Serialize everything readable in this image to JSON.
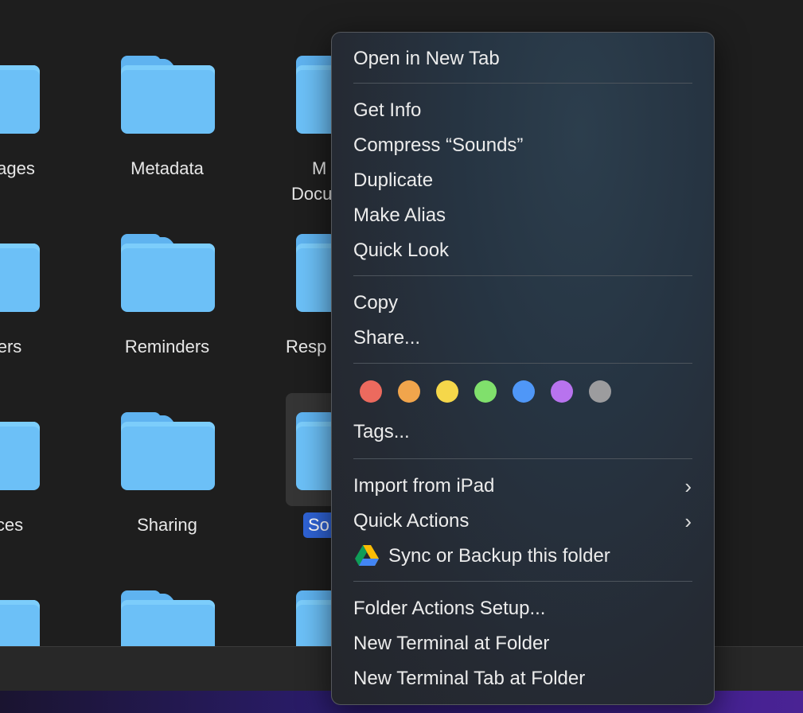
{
  "folders": {
    "row1": [
      "ages",
      "Metadata",
      "M",
      "Docu"
    ],
    "row2": [
      "ers",
      "Reminders",
      "Resp"
    ],
    "row3": [
      "ces",
      "Sharing",
      "So"
    ]
  },
  "menu": {
    "open_new_tab": "Open in New Tab",
    "get_info": "Get Info",
    "compress": "Compress “Sounds”",
    "duplicate": "Duplicate",
    "make_alias": "Make Alias",
    "quick_look": "Quick Look",
    "copy": "Copy",
    "share": "Share...",
    "tags": "Tags...",
    "import_ipad": "Import from iPad",
    "quick_actions": "Quick Actions",
    "sync_backup": "Sync or Backup this folder",
    "folder_actions": "Folder Actions Setup...",
    "new_terminal": "New Terminal at Folder",
    "new_terminal_tab": "New Terminal Tab at Folder"
  },
  "tag_colors": {
    "red": "#ec6a5e",
    "orange": "#f1a54c",
    "yellow": "#f5d74a",
    "green": "#80e06c",
    "blue": "#4f97f7",
    "purple": "#b873ee",
    "gray": "#9c9c9e"
  },
  "icons": {
    "submenu": "chevron-right-icon",
    "google_drive": "google-drive-icon"
  }
}
